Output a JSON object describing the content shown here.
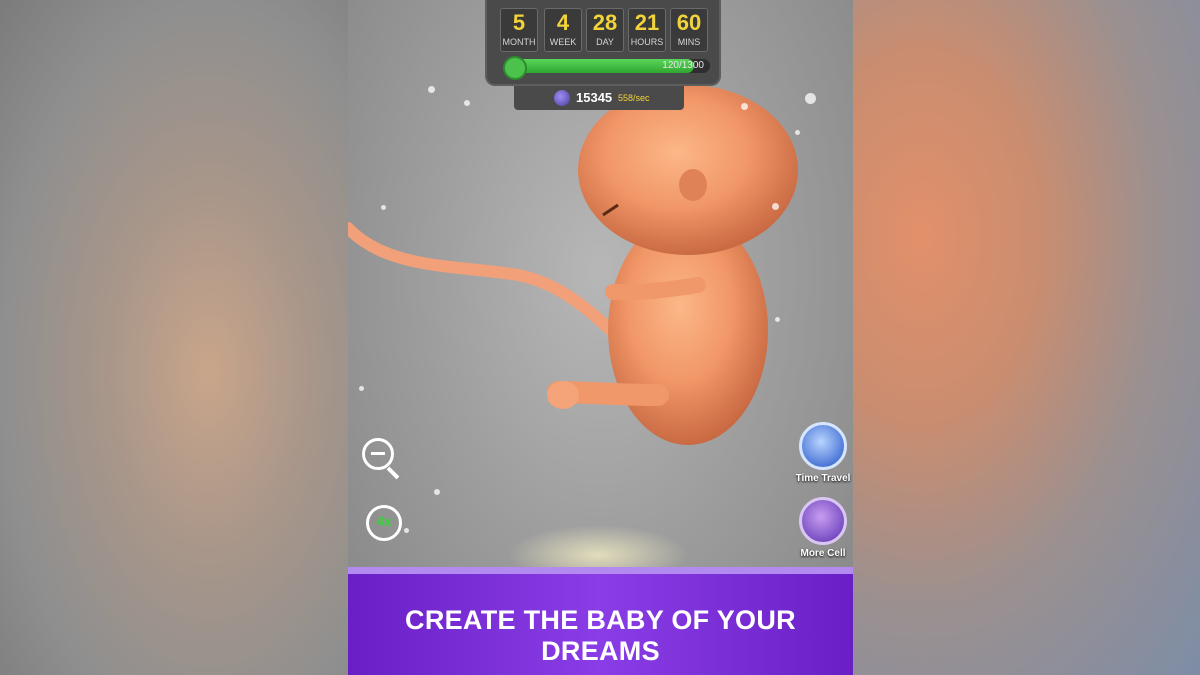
{
  "timer": {
    "units": [
      {
        "value": "5",
        "label": "MONTH"
      },
      {
        "value": "4",
        "label": "WEEK"
      },
      {
        "value": "28",
        "label": "DAY"
      },
      {
        "value": "21",
        "label": "HOURS"
      },
      {
        "value": "60",
        "label": "MINS"
      }
    ],
    "progress_text": "120/1300",
    "progress_fraction": 0.92
  },
  "currency": {
    "amount": "15345",
    "rate": "558/sec",
    "icon": "cell-icon"
  },
  "controls": {
    "zoom_icon": "zoom-out-icon",
    "speed_label": "4x"
  },
  "side_buttons": {
    "time_travel": "Time Travel",
    "more_cell": "More Cell"
  },
  "banner": {
    "text": "CREATE THE BABY OF YOUR DREAMS"
  },
  "colors": {
    "accent_yellow": "#f2d33a",
    "progress_green": "#3dbb3d",
    "banner_purple": "#7a2fd8"
  }
}
